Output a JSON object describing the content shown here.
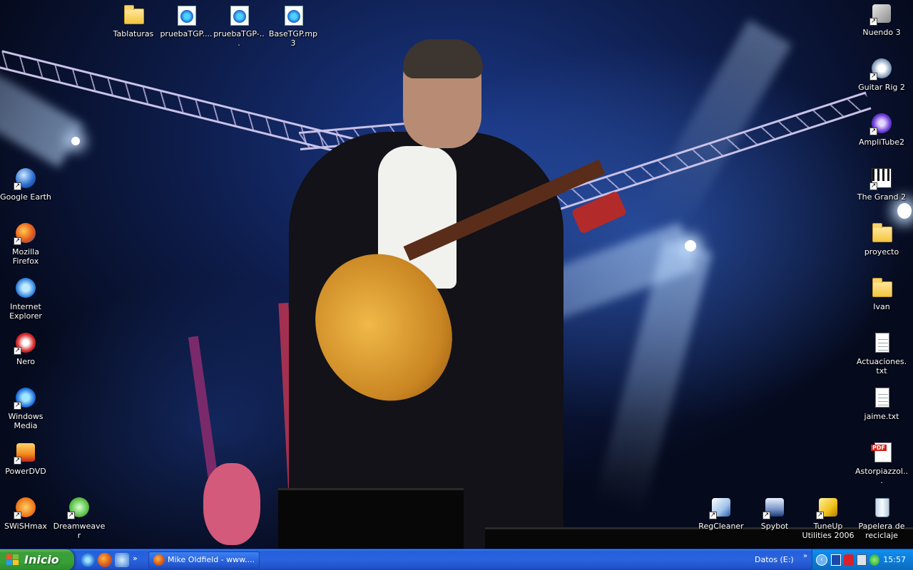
{
  "desktop": {
    "top_icons": [
      {
        "label": "Tablaturas",
        "type": "folder"
      },
      {
        "label": "pruebaTGP....",
        "type": "media"
      },
      {
        "label": "pruebaTGP-...",
        "type": "media"
      },
      {
        "label": "BaseTGP.mp3",
        "type": "media"
      }
    ],
    "left_icons": [
      {
        "label": "Google Earth",
        "type": "globe"
      },
      {
        "label": "Mozilla Firefox",
        "type": "firefox"
      },
      {
        "label": "Internet Explorer",
        "type": "ie"
      },
      {
        "label": "Nero",
        "type": "nero"
      },
      {
        "label": "Windows Media",
        "type": "wmp"
      },
      {
        "label": "PowerDVD",
        "type": "dvd"
      }
    ],
    "bottom_left_icons": [
      {
        "label": "SWiSHmax",
        "type": "swish"
      },
      {
        "label": "Dreamweaver",
        "type": "dreamweaver"
      }
    ],
    "right_icons": [
      {
        "label": "Nuendo 3",
        "type": "nuendo"
      },
      {
        "label": "Guitar Rig 2",
        "type": "guitarrig"
      },
      {
        "label": "AmpliTube2",
        "type": "amplitube"
      },
      {
        "label": "The Grand 2",
        "type": "piano"
      },
      {
        "label": "proyecto",
        "type": "folder"
      },
      {
        "label": "Ivan",
        "type": "folder"
      },
      {
        "label": "Actuaciones.txt",
        "type": "text"
      },
      {
        "label": "jaime.txt",
        "type": "text"
      },
      {
        "label": "Astorpiazzol...",
        "type": "pdf"
      }
    ],
    "bottom_right_icons": [
      {
        "label": "RegCleaner",
        "type": "regcleaner"
      },
      {
        "label": "Spybot",
        "type": "spybot"
      },
      {
        "label": "TuneUp Utilities 2006",
        "type": "tuneup"
      },
      {
        "label": "Papelera de reciclaje",
        "type": "recycle"
      }
    ]
  },
  "taskbar": {
    "start_label": "Inicio",
    "quick_launch": [
      "ie-icon",
      "firefox-icon",
      "outlook-icon"
    ],
    "quick_launch_more": "»",
    "window_button": "Mike Oldfield - www....",
    "toolbar_label": "Datos (E:)",
    "toolbar_more": "»",
    "tray_expand": "‹",
    "clock": "15:57"
  },
  "colors": {
    "taskbar": "#245edb",
    "start_button": "#3c9e3a",
    "tray": "#0e8bed"
  }
}
